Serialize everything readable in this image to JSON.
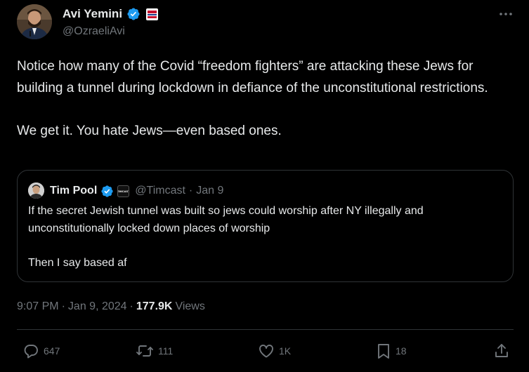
{
  "author": {
    "display_name": "Avi Yemini",
    "handle": "@OzraeliAvi",
    "verified_icon": "verified-badge-icon",
    "affiliation_icon": "rebel-news-affiliate-icon"
  },
  "post": {
    "text": "Notice how many of the Covid “freedom fighters” are attacking these Jews for building a tunnel during lockdown in defiance of the unconstitutional restrictions.\n\nWe get it. You hate Jews—even based ones.",
    "time": "9:07 PM",
    "date": "Jan 9, 2024",
    "separator": "·",
    "views_count": "177.9K",
    "views_label": "Views"
  },
  "quoted": {
    "display_name": "Tim Pool",
    "handle": "@Timcast",
    "separator": "·",
    "date": "Jan 9",
    "affiliation_label": "TIMCAST",
    "text": "If the secret Jewish tunnel was built so jews could worship after NY illegally and unconstitutionally locked down places of worship\n\nThen I say based af"
  },
  "actions": {
    "replies": "647",
    "reposts": "111",
    "likes": "1K",
    "bookmarks": "18"
  },
  "colors": {
    "background": "#000000",
    "text_primary": "#e7e9ea",
    "text_secondary": "#71767b",
    "border": "#2f3336",
    "verified_blue": "#1d9bf0"
  }
}
